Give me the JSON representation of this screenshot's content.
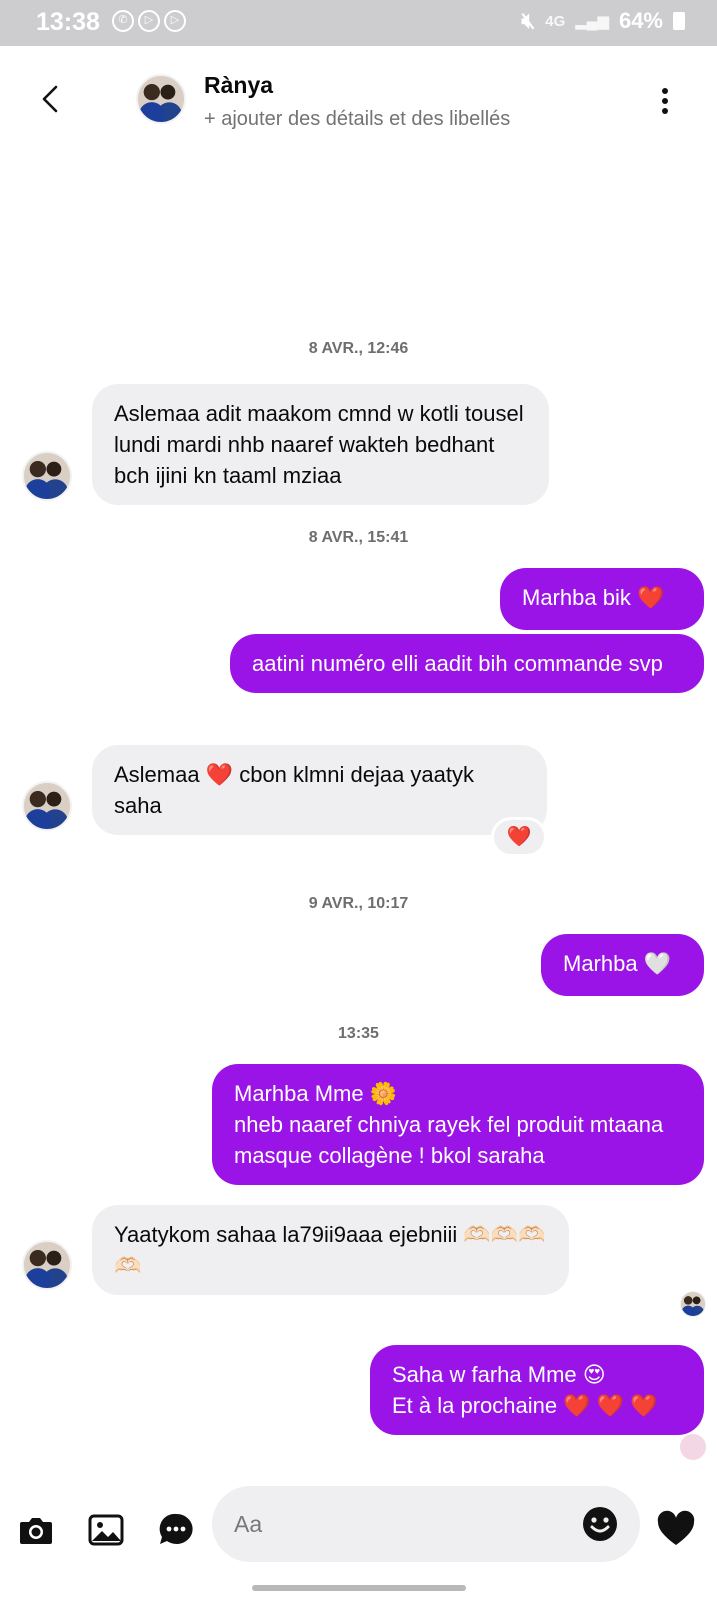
{
  "status_bar": {
    "time": "13:38",
    "network": "4G",
    "battery": "64%"
  },
  "header": {
    "contact_name": "Rànya",
    "subtitle": "+ ajouter des détails et des libellés"
  },
  "timestamps": [
    "8 AVR., 12:46",
    "8 AVR., 15:41",
    "9 AVR., 10:17",
    "13:35"
  ],
  "messages": [
    {
      "from": "contact",
      "text": "Aslemaa adit maakom cmnd w kotli tousel lundi mardi nhb naaref wakteh bedhant bch ijini kn taaml mziaa"
    },
    {
      "from": "me",
      "text": "Marhba bik ❤️"
    },
    {
      "from": "me",
      "text": "aatini numéro elli aadit bih commande svp"
    },
    {
      "from": "contact",
      "text": "Aslemaa ❤️ cbon klmni dejaa yaatyk saha",
      "reaction": "❤️"
    },
    {
      "from": "me",
      "text": "Marhba 🤍"
    },
    {
      "from": "me",
      "line1": "Marhba Mme 🌼",
      "line2": "nheb naaref chniya rayek fel produit mtaana masque collagène ! bkol saraha"
    },
    {
      "from": "contact",
      "text": "Yaatykom sahaa la79ii9aaa ejebniii 🫶🏻🫶🏻🫶🏻🫶🏻"
    },
    {
      "from": "me",
      "line1": "Saha w farha Mme 😍",
      "line2": "Et à la prochaine ❤️ ❤️ ❤️"
    }
  ],
  "composer": {
    "placeholder": "Aa"
  },
  "icons": [
    "back-chevron-icon",
    "more-vertical-icon",
    "camera-icon",
    "gallery-icon",
    "chat-bubble-icon",
    "emoji-icon",
    "heart-icon"
  ]
}
